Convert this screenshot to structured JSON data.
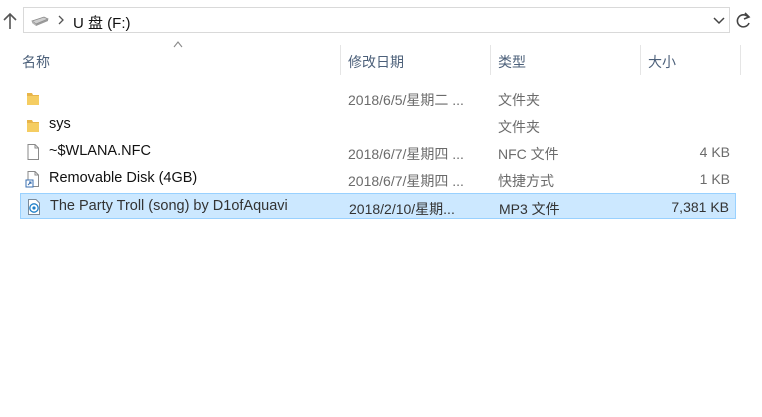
{
  "address_bar": {
    "path": "U 盘 (F:)",
    "icons": {
      "up": "arrow-up-icon",
      "drive": "usb-drive-icon",
      "separator": "chevron-right-icon",
      "dropdown": "chevron-down-icon",
      "refresh": "refresh-icon"
    }
  },
  "columns": {
    "name": "名称",
    "date": "修改日期",
    "type": "类型",
    "size": "大小"
  },
  "files": [
    {
      "icon": "folder-icon",
      "name": "",
      "date": "2018/6/5/星期二 ...",
      "type": "文件夹",
      "size": ""
    },
    {
      "icon": "folder-icon",
      "name": "sys",
      "date": "",
      "type": "文件夹",
      "size": ""
    },
    {
      "icon": "file-icon",
      "name": "~$WLANA.NFC",
      "date": "2018/6/7/星期四 ...",
      "type": "NFC 文件",
      "size": "4 KB"
    },
    {
      "icon": "shortcut-icon",
      "name": "Removable Disk (4GB)",
      "date": "2018/6/7/星期四 ...",
      "type": "快捷方式",
      "size": "1 KB"
    },
    {
      "icon": "audio-file-icon",
      "name": "The Party Troll (song) by D1ofAquavi",
      "date": "2018/2/10/星期...",
      "type": "MP3 文件",
      "size": "7,381 KB",
      "selected": true
    }
  ],
  "colors": {
    "selection_bg": "#cce8ff",
    "selection_border": "#99d1ff",
    "header_text": "#4c607a",
    "folder": "#e8b54a"
  }
}
